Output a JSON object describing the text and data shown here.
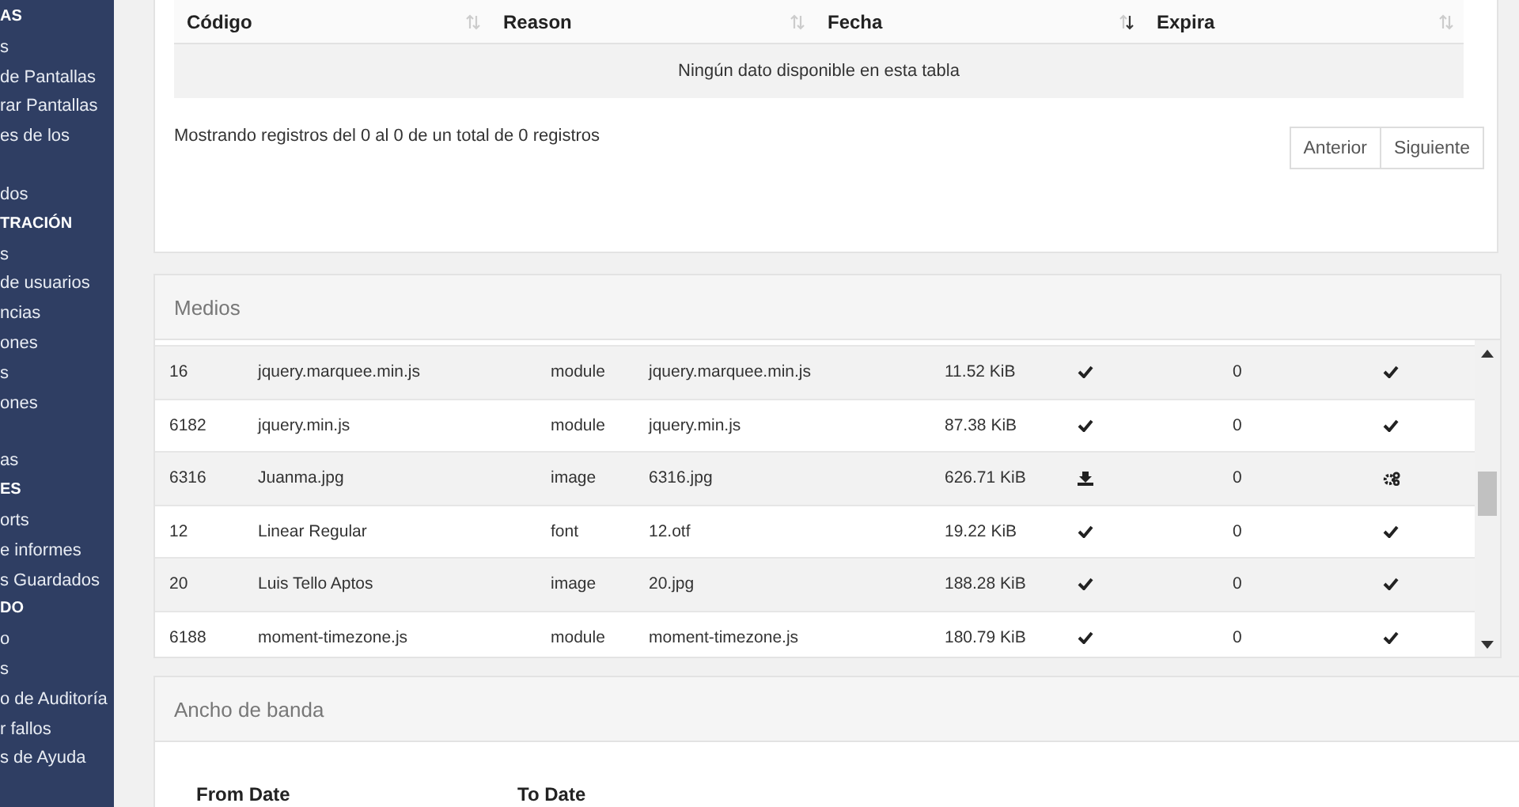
{
  "sidebar": {
    "items": [
      {
        "kind": "header",
        "label": "AS"
      },
      {
        "kind": "item",
        "label": "s"
      },
      {
        "kind": "item",
        "label": "de Pantallas"
      },
      {
        "kind": "item",
        "label": "rar Pantallas"
      },
      {
        "kind": "item",
        "label": "es de los",
        "wrapped": true
      },
      {
        "kind": "item",
        "label": "dos"
      },
      {
        "kind": "header",
        "label": "TRACIÓN"
      },
      {
        "kind": "item",
        "label": "s"
      },
      {
        "kind": "item",
        "label": "de usuarios"
      },
      {
        "kind": "item",
        "label": "ncias"
      },
      {
        "kind": "item",
        "label": "ones"
      },
      {
        "kind": "item",
        "label": "s"
      },
      {
        "kind": "item",
        "label": "ones",
        "wrapped": true
      },
      {
        "kind": "item",
        "label": "as"
      },
      {
        "kind": "header",
        "label": "ES"
      },
      {
        "kind": "item",
        "label": "orts"
      },
      {
        "kind": "item",
        "label": "e informes"
      },
      {
        "kind": "item",
        "label": "s Guardados"
      },
      {
        "kind": "header",
        "label": "DO"
      },
      {
        "kind": "item",
        "label": "o"
      },
      {
        "kind": "item",
        "label": "s"
      },
      {
        "kind": "item",
        "label": "o de Auditoría"
      },
      {
        "kind": "item",
        "label": "r fallos"
      },
      {
        "kind": "item",
        "label": "s de Ayuda"
      }
    ]
  },
  "codes_table": {
    "columns": [
      {
        "label": "Código",
        "sorted": false
      },
      {
        "label": "Reason",
        "sorted": false
      },
      {
        "label": "Fecha",
        "sorted": true
      },
      {
        "label": "Expira",
        "sorted": false
      }
    ],
    "empty_message": "Ningún dato disponible en esta tabla",
    "info": "Mostrando registros del 0 al 0 de un total de 0 registros",
    "pagination": [
      "Anterior",
      "Siguiente"
    ]
  },
  "media_panel": {
    "title": "Medios",
    "rows": [
      {
        "cells": [
          "16",
          "jquery.marquee.min.js",
          "module",
          "jquery.marquee.min.js",
          "11.52 KiB"
        ],
        "status": {
          "kind": "check"
        },
        "count": "0",
        "action": {
          "kind": "check"
        }
      },
      {
        "cells": [
          "6182",
          "jquery.min.js",
          "module",
          "jquery.min.js",
          "87.38 KiB"
        ],
        "status": {
          "kind": "check"
        },
        "count": "0",
        "action": {
          "kind": "check"
        }
      },
      {
        "cells": [
          "6316",
          "Juanma.jpg",
          "image",
          "6316.jpg",
          "626.71 KiB"
        ],
        "status": {
          "kind": "download"
        },
        "count": "0",
        "action": {
          "kind": "gears"
        }
      },
      {
        "cells": [
          "12",
          "Linear Regular",
          "font",
          "12.otf",
          "19.22 KiB"
        ],
        "status": {
          "kind": "check"
        },
        "count": "0",
        "action": {
          "kind": "check"
        }
      },
      {
        "cells": [
          "20",
          "Luis Tello Aptos",
          "image",
          "20.jpg",
          "188.28 KiB"
        ],
        "status": {
          "kind": "check"
        },
        "count": "0",
        "action": {
          "kind": "check"
        }
      },
      {
        "cells": [
          "6188",
          "moment-timezone.js",
          "module",
          "moment-timezone.js",
          "180.79 KiB"
        ],
        "status": {
          "kind": "check"
        },
        "count": "0",
        "action": {
          "kind": "check"
        }
      }
    ]
  },
  "bandwidth_panel": {
    "title": "Ancho de banda",
    "labels": [
      "From Date",
      "To Date"
    ]
  }
}
